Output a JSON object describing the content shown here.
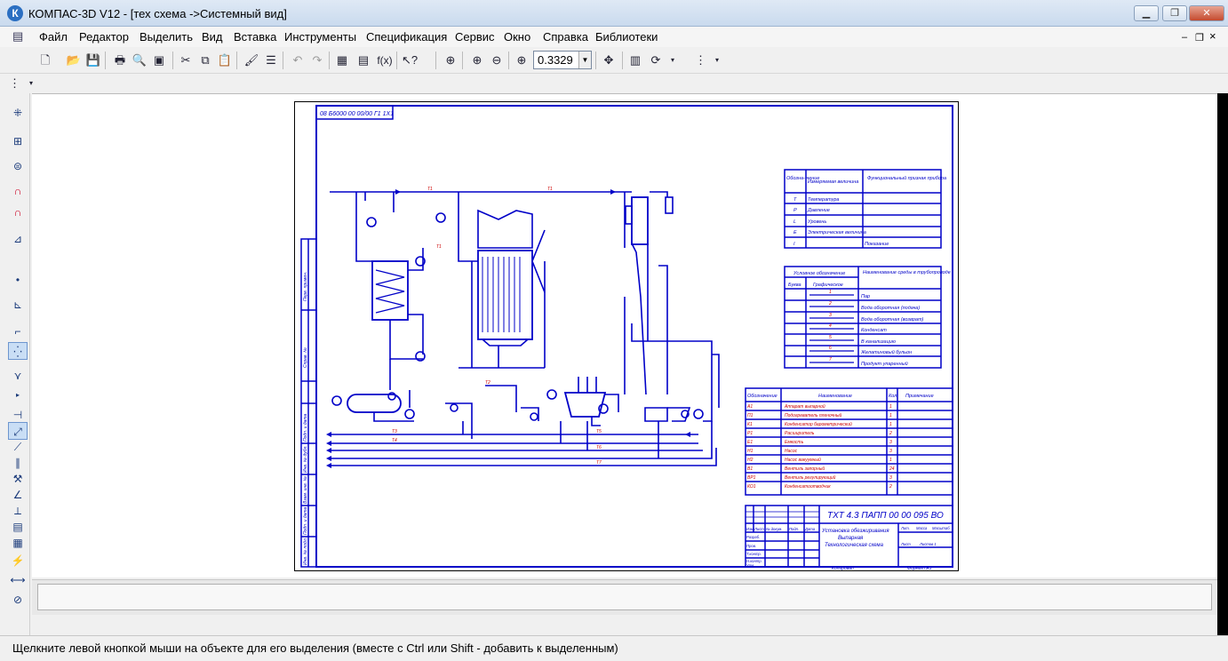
{
  "window": {
    "title": "КОМПАС-3D V12 - [тех схема ->Системный вид]",
    "app_icon_letter": "К",
    "controls": {
      "minimize": "▁",
      "maximize": "❐",
      "close": "✕"
    }
  },
  "menu": {
    "items": [
      "Файл",
      "Редактор",
      "Выделить",
      "Вид",
      "Вставка",
      "Инструменты",
      "Спецификация",
      "Сервис",
      "Окно",
      "Справка",
      "Библиотеки"
    ],
    "mdi_controls": {
      "minimize": "–",
      "restore": "❐",
      "close": "×"
    }
  },
  "toolbar": {
    "zoom_value": "0.3329",
    "zoom_dropdown_icon": "▼",
    "fx_label": "f(x)"
  },
  "drawing": {
    "doc_code_topleft": "08 Б6000 00 00/00 Г1 1Х1",
    "title_block_code": "ТХТ 4.3 ПАПП 00 00 095 ВО",
    "title_block_name_lines": [
      "Установка обезжиривания",
      "Выпарная",
      "Технологическая схема"
    ],
    "footer_left": "Копировал",
    "footer_right": "Формат   А3",
    "instrument_table": {
      "headers": [
        "Обозна-\nчение",
        "Измеряемая величина",
        "Функциональный признак прибора"
      ],
      "rows": [
        [
          "T",
          "Температура",
          ""
        ],
        [
          "P",
          "Давление",
          ""
        ],
        [
          "L",
          "Уровень",
          ""
        ],
        [
          "E",
          "Электрическая величина",
          ""
        ],
        [
          "I",
          "",
          "Показание"
        ]
      ]
    },
    "legend_table": {
      "headers": [
        "Условное обозначение",
        "Наименование среды в трубопроводе"
      ],
      "subheaders": [
        "Буква",
        "Графическое"
      ],
      "rows": [
        [
          "Пар",
          "1"
        ],
        [
          "Вода оборотная (подача)",
          "2"
        ],
        [
          "Вода оборотная (возврат)",
          "3"
        ],
        [
          "Конденсат",
          "4"
        ],
        [
          "В канализацию",
          "5"
        ],
        [
          "Желатиновый бульон",
          "6"
        ],
        [
          "Продукт упаренный",
          "7"
        ]
      ]
    },
    "equipment_table": {
      "headers": [
        "Обозначение",
        "Наименование",
        "Кол.",
        "Примечание"
      ],
      "rows": [
        [
          "А1",
          "Аппарат выпарной",
          "1"
        ],
        [
          "П1",
          "Подогреватель пленочный",
          "1"
        ],
        [
          "К1",
          "Конденсатор барометрический",
          "1"
        ],
        [
          "Р1",
          "Расширитель",
          "2"
        ],
        [
          "Е1",
          "Емкость",
          "3"
        ],
        [
          "Н1",
          "Насос",
          "3"
        ],
        [
          "Н2",
          "Насос вакуумный",
          "1"
        ],
        [
          "В1",
          "Вентиль запорный",
          "24"
        ],
        [
          "ВР1",
          "Вентиль регулирующий",
          "3"
        ],
        [
          "КО1",
          "Конденсатоотводчик",
          "2"
        ]
      ]
    },
    "vertical_stamp_labels": [
      "Перв. примен.",
      "Справ. №",
      "Подп. и дата",
      "Инв. № дубл.",
      "Взам. инв. №",
      "Подп. и дата",
      "Инв. № подл."
    ],
    "title_block_row_labels": [
      "Изм.",
      "Лист",
      "№ докум.",
      "Подп.",
      "Дата",
      "Разраб.",
      "Пров.",
      "Т.контр.",
      "Н.контр.",
      "Утв."
    ],
    "title_block_cells": [
      "Лит.",
      "Масса",
      "Масштаб",
      "Лист",
      "Листов 1"
    ],
    "line_labels": [
      "Т1",
      "Т1",
      "Т1",
      "Т2",
      "Т3",
      "Т4",
      "Т5",
      "Т6",
      "Т7"
    ]
  },
  "status": {
    "hint": "Щелкните левой кнопкой мыши на объекте для его выделения (вместе с Ctrl или Shift - добавить к выделенным)"
  }
}
